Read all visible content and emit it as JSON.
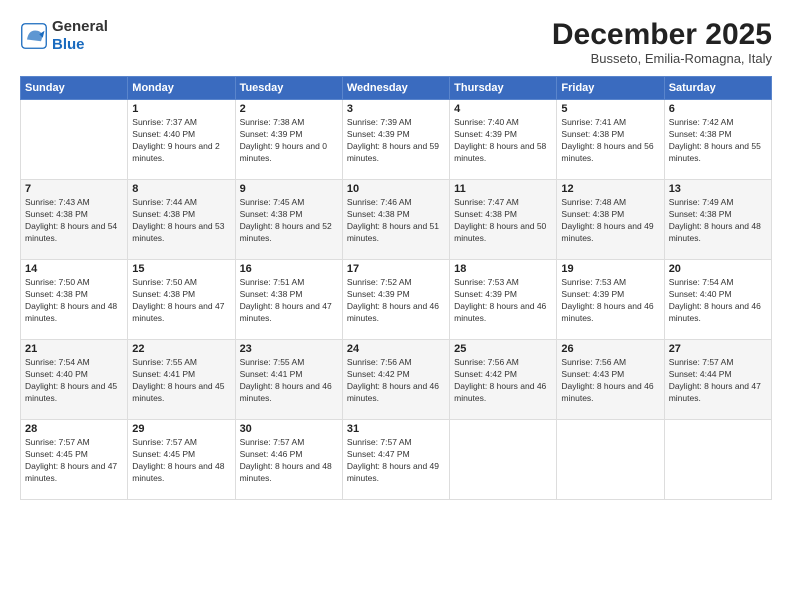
{
  "logo": {
    "general": "General",
    "blue": "Blue"
  },
  "header": {
    "month_title": "December 2025",
    "subtitle": "Busseto, Emilia-Romagna, Italy"
  },
  "weekdays": [
    "Sunday",
    "Monday",
    "Tuesday",
    "Wednesday",
    "Thursday",
    "Friday",
    "Saturday"
  ],
  "weeks": [
    [
      {
        "day": "",
        "sunrise": "",
        "sunset": "",
        "daylight": ""
      },
      {
        "day": "1",
        "sunrise": "Sunrise: 7:37 AM",
        "sunset": "Sunset: 4:40 PM",
        "daylight": "Daylight: 9 hours and 2 minutes."
      },
      {
        "day": "2",
        "sunrise": "Sunrise: 7:38 AM",
        "sunset": "Sunset: 4:39 PM",
        "daylight": "Daylight: 9 hours and 0 minutes."
      },
      {
        "day": "3",
        "sunrise": "Sunrise: 7:39 AM",
        "sunset": "Sunset: 4:39 PM",
        "daylight": "Daylight: 8 hours and 59 minutes."
      },
      {
        "day": "4",
        "sunrise": "Sunrise: 7:40 AM",
        "sunset": "Sunset: 4:39 PM",
        "daylight": "Daylight: 8 hours and 58 minutes."
      },
      {
        "day": "5",
        "sunrise": "Sunrise: 7:41 AM",
        "sunset": "Sunset: 4:38 PM",
        "daylight": "Daylight: 8 hours and 56 minutes."
      },
      {
        "day": "6",
        "sunrise": "Sunrise: 7:42 AM",
        "sunset": "Sunset: 4:38 PM",
        "daylight": "Daylight: 8 hours and 55 minutes."
      }
    ],
    [
      {
        "day": "7",
        "sunrise": "Sunrise: 7:43 AM",
        "sunset": "Sunset: 4:38 PM",
        "daylight": "Daylight: 8 hours and 54 minutes."
      },
      {
        "day": "8",
        "sunrise": "Sunrise: 7:44 AM",
        "sunset": "Sunset: 4:38 PM",
        "daylight": "Daylight: 8 hours and 53 minutes."
      },
      {
        "day": "9",
        "sunrise": "Sunrise: 7:45 AM",
        "sunset": "Sunset: 4:38 PM",
        "daylight": "Daylight: 8 hours and 52 minutes."
      },
      {
        "day": "10",
        "sunrise": "Sunrise: 7:46 AM",
        "sunset": "Sunset: 4:38 PM",
        "daylight": "Daylight: 8 hours and 51 minutes."
      },
      {
        "day": "11",
        "sunrise": "Sunrise: 7:47 AM",
        "sunset": "Sunset: 4:38 PM",
        "daylight": "Daylight: 8 hours and 50 minutes."
      },
      {
        "day": "12",
        "sunrise": "Sunrise: 7:48 AM",
        "sunset": "Sunset: 4:38 PM",
        "daylight": "Daylight: 8 hours and 49 minutes."
      },
      {
        "day": "13",
        "sunrise": "Sunrise: 7:49 AM",
        "sunset": "Sunset: 4:38 PM",
        "daylight": "Daylight: 8 hours and 48 minutes."
      }
    ],
    [
      {
        "day": "14",
        "sunrise": "Sunrise: 7:50 AM",
        "sunset": "Sunset: 4:38 PM",
        "daylight": "Daylight: 8 hours and 48 minutes."
      },
      {
        "day": "15",
        "sunrise": "Sunrise: 7:50 AM",
        "sunset": "Sunset: 4:38 PM",
        "daylight": "Daylight: 8 hours and 47 minutes."
      },
      {
        "day": "16",
        "sunrise": "Sunrise: 7:51 AM",
        "sunset": "Sunset: 4:38 PM",
        "daylight": "Daylight: 8 hours and 47 minutes."
      },
      {
        "day": "17",
        "sunrise": "Sunrise: 7:52 AM",
        "sunset": "Sunset: 4:39 PM",
        "daylight": "Daylight: 8 hours and 46 minutes."
      },
      {
        "day": "18",
        "sunrise": "Sunrise: 7:53 AM",
        "sunset": "Sunset: 4:39 PM",
        "daylight": "Daylight: 8 hours and 46 minutes."
      },
      {
        "day": "19",
        "sunrise": "Sunrise: 7:53 AM",
        "sunset": "Sunset: 4:39 PM",
        "daylight": "Daylight: 8 hours and 46 minutes."
      },
      {
        "day": "20",
        "sunrise": "Sunrise: 7:54 AM",
        "sunset": "Sunset: 4:40 PM",
        "daylight": "Daylight: 8 hours and 46 minutes."
      }
    ],
    [
      {
        "day": "21",
        "sunrise": "Sunrise: 7:54 AM",
        "sunset": "Sunset: 4:40 PM",
        "daylight": "Daylight: 8 hours and 45 minutes."
      },
      {
        "day": "22",
        "sunrise": "Sunrise: 7:55 AM",
        "sunset": "Sunset: 4:41 PM",
        "daylight": "Daylight: 8 hours and 45 minutes."
      },
      {
        "day": "23",
        "sunrise": "Sunrise: 7:55 AM",
        "sunset": "Sunset: 4:41 PM",
        "daylight": "Daylight: 8 hours and 46 minutes."
      },
      {
        "day": "24",
        "sunrise": "Sunrise: 7:56 AM",
        "sunset": "Sunset: 4:42 PM",
        "daylight": "Daylight: 8 hours and 46 minutes."
      },
      {
        "day": "25",
        "sunrise": "Sunrise: 7:56 AM",
        "sunset": "Sunset: 4:42 PM",
        "daylight": "Daylight: 8 hours and 46 minutes."
      },
      {
        "day": "26",
        "sunrise": "Sunrise: 7:56 AM",
        "sunset": "Sunset: 4:43 PM",
        "daylight": "Daylight: 8 hours and 46 minutes."
      },
      {
        "day": "27",
        "sunrise": "Sunrise: 7:57 AM",
        "sunset": "Sunset: 4:44 PM",
        "daylight": "Daylight: 8 hours and 47 minutes."
      }
    ],
    [
      {
        "day": "28",
        "sunrise": "Sunrise: 7:57 AM",
        "sunset": "Sunset: 4:45 PM",
        "daylight": "Daylight: 8 hours and 47 minutes."
      },
      {
        "day": "29",
        "sunrise": "Sunrise: 7:57 AM",
        "sunset": "Sunset: 4:45 PM",
        "daylight": "Daylight: 8 hours and 48 minutes."
      },
      {
        "day": "30",
        "sunrise": "Sunrise: 7:57 AM",
        "sunset": "Sunset: 4:46 PM",
        "daylight": "Daylight: 8 hours and 48 minutes."
      },
      {
        "day": "31",
        "sunrise": "Sunrise: 7:57 AM",
        "sunset": "Sunset: 4:47 PM",
        "daylight": "Daylight: 8 hours and 49 minutes."
      },
      {
        "day": "",
        "sunrise": "",
        "sunset": "",
        "daylight": ""
      },
      {
        "day": "",
        "sunrise": "",
        "sunset": "",
        "daylight": ""
      },
      {
        "day": "",
        "sunrise": "",
        "sunset": "",
        "daylight": ""
      }
    ]
  ]
}
